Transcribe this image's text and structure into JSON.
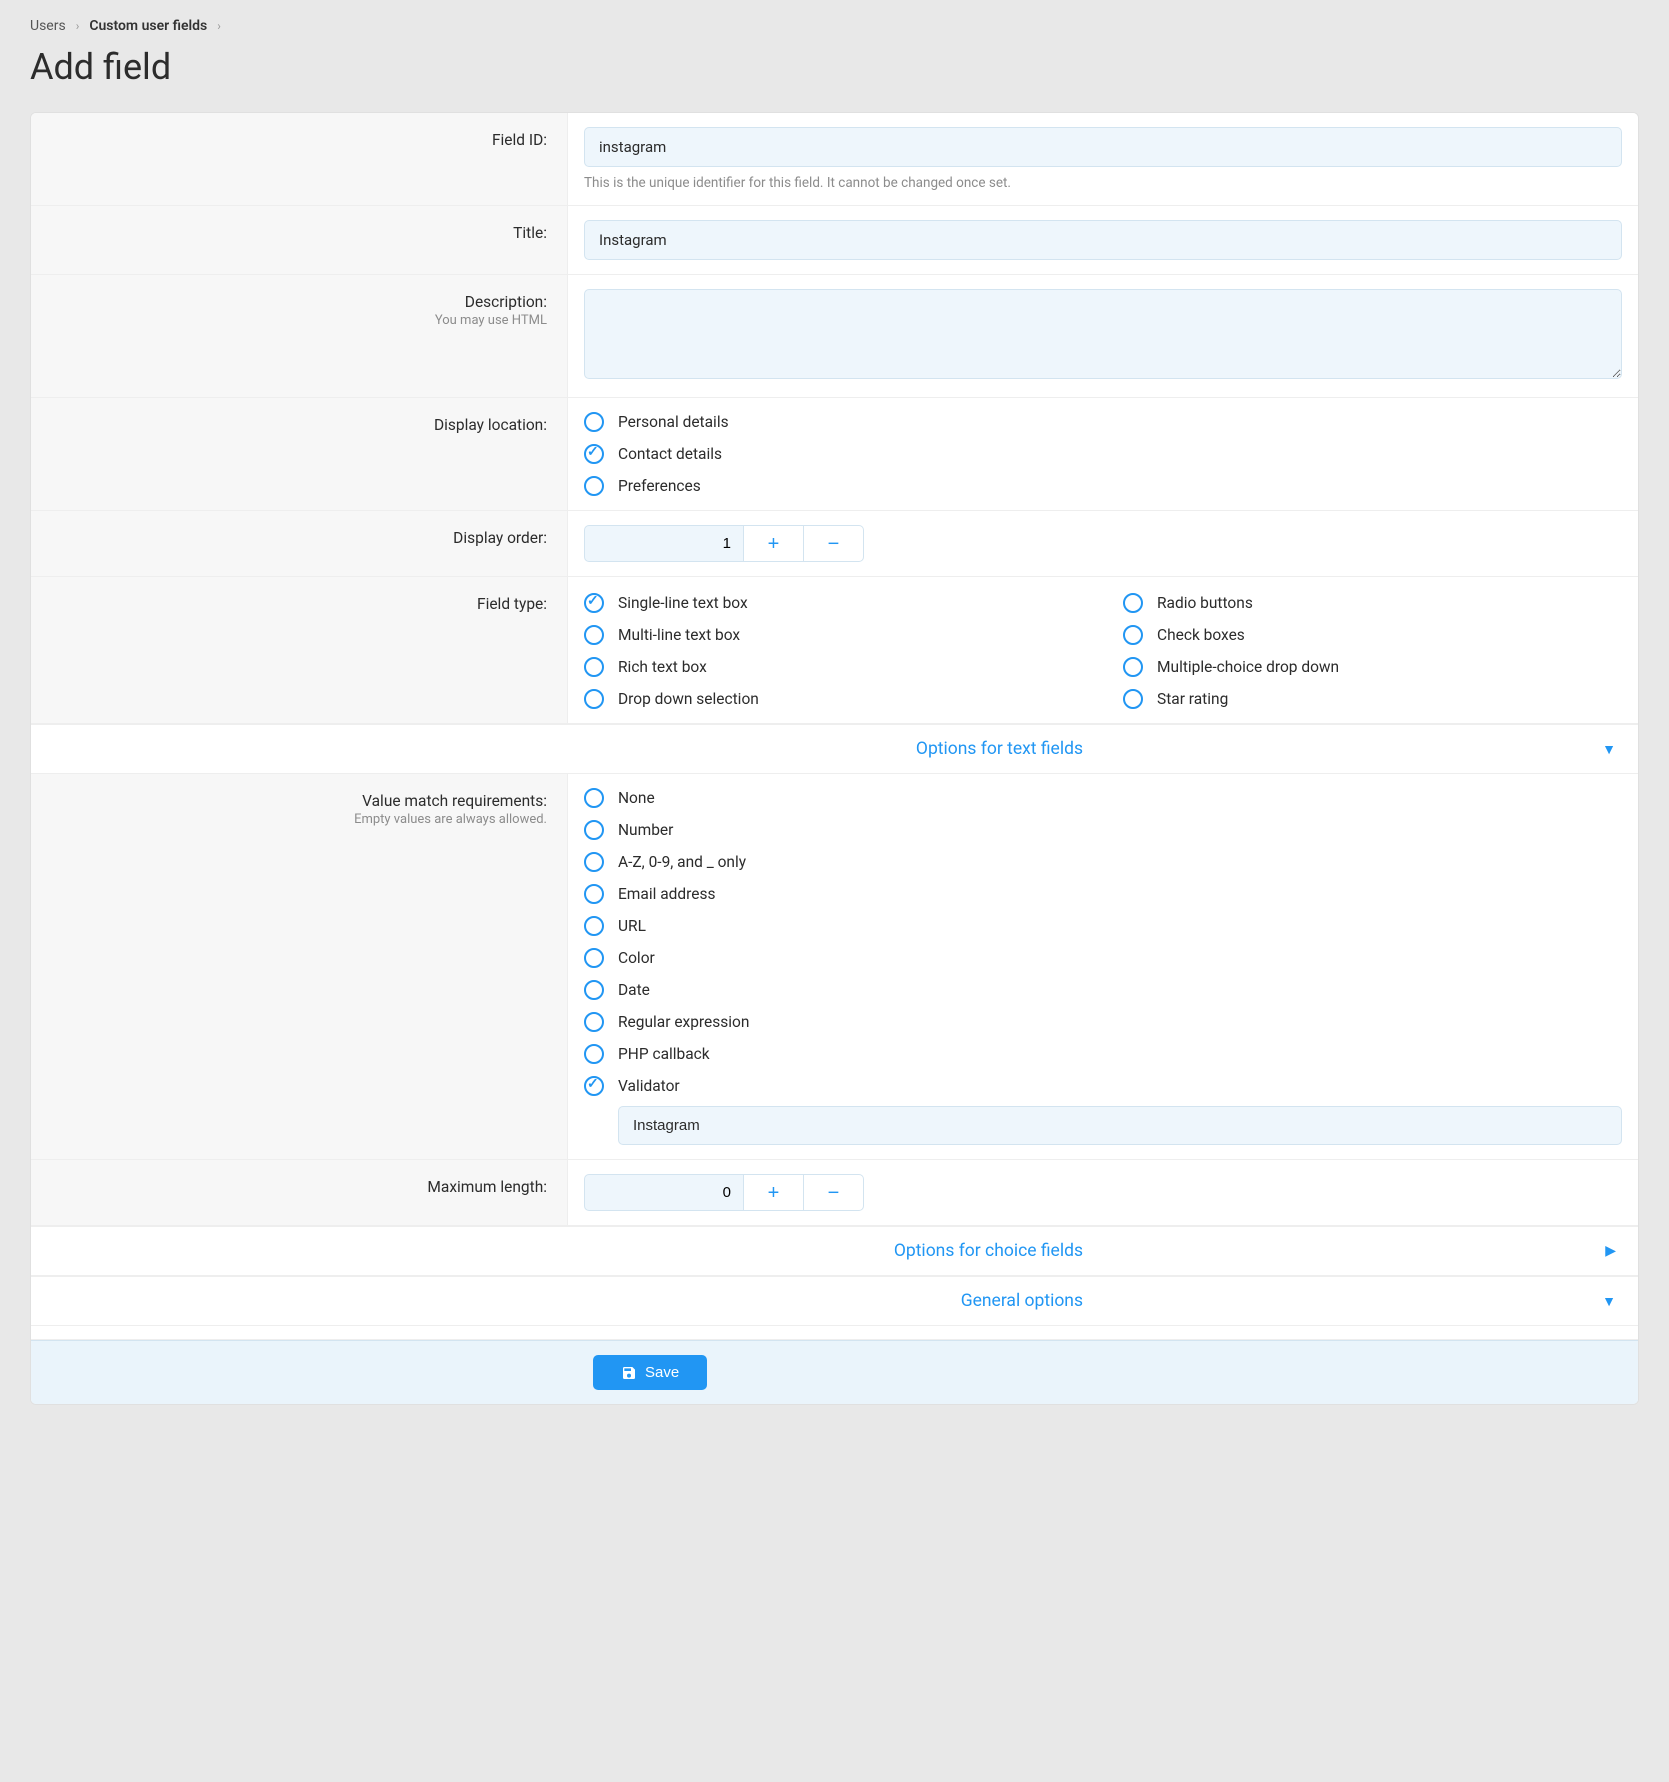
{
  "breadcrumb": {
    "users": "Users",
    "custom": "Custom user fields"
  },
  "page_title": "Add field",
  "field_id": {
    "label": "Field ID:",
    "value": "instagram",
    "help": "This is the unique identifier for this field. It cannot be changed once set."
  },
  "title": {
    "label": "Title:",
    "value": "Instagram"
  },
  "description": {
    "label": "Description:",
    "hint": "You may use HTML",
    "value": ""
  },
  "display_location": {
    "label": "Display location:",
    "options": [
      {
        "key": "personal",
        "label": "Personal details",
        "selected": false
      },
      {
        "key": "contact",
        "label": "Contact details",
        "selected": true
      },
      {
        "key": "pref",
        "label": "Preferences",
        "selected": false
      }
    ]
  },
  "display_order": {
    "label": "Display order:",
    "value": "1"
  },
  "field_type": {
    "label": "Field type:",
    "options_left": [
      {
        "key": "single",
        "label": "Single-line text box",
        "selected": true
      },
      {
        "key": "multi",
        "label": "Multi-line text box",
        "selected": false
      },
      {
        "key": "rich",
        "label": "Rich text box",
        "selected": false
      },
      {
        "key": "dropdown",
        "label": "Drop down selection",
        "selected": false
      }
    ],
    "options_right": [
      {
        "key": "radio",
        "label": "Radio buttons",
        "selected": false
      },
      {
        "key": "check",
        "label": "Check boxes",
        "selected": false
      },
      {
        "key": "mcdrop",
        "label": "Multiple-choice drop down",
        "selected": false
      },
      {
        "key": "star",
        "label": "Star rating",
        "selected": false
      }
    ]
  },
  "sections": {
    "text_options": "Options for text fields",
    "choice_options": "Options for choice fields",
    "general": "General options"
  },
  "value_match": {
    "label": "Value match requirements:",
    "hint": "Empty values are always allowed.",
    "options": [
      {
        "key": "none",
        "label": "None",
        "selected": false
      },
      {
        "key": "number",
        "label": "Number",
        "selected": false
      },
      {
        "key": "alnum",
        "label": "A-Z, 0-9, and _ only",
        "selected": false
      },
      {
        "key": "email",
        "label": "Email address",
        "selected": false
      },
      {
        "key": "url",
        "label": "URL",
        "selected": false
      },
      {
        "key": "color",
        "label": "Color",
        "selected": false
      },
      {
        "key": "date",
        "label": "Date",
        "selected": false
      },
      {
        "key": "regex",
        "label": "Regular expression",
        "selected": false
      },
      {
        "key": "php",
        "label": "PHP callback",
        "selected": false
      },
      {
        "key": "validator",
        "label": "Validator",
        "selected": true
      }
    ],
    "validator_value": "Instagram"
  },
  "max_length": {
    "label": "Maximum length:",
    "value": "0"
  },
  "save_label": "Save"
}
